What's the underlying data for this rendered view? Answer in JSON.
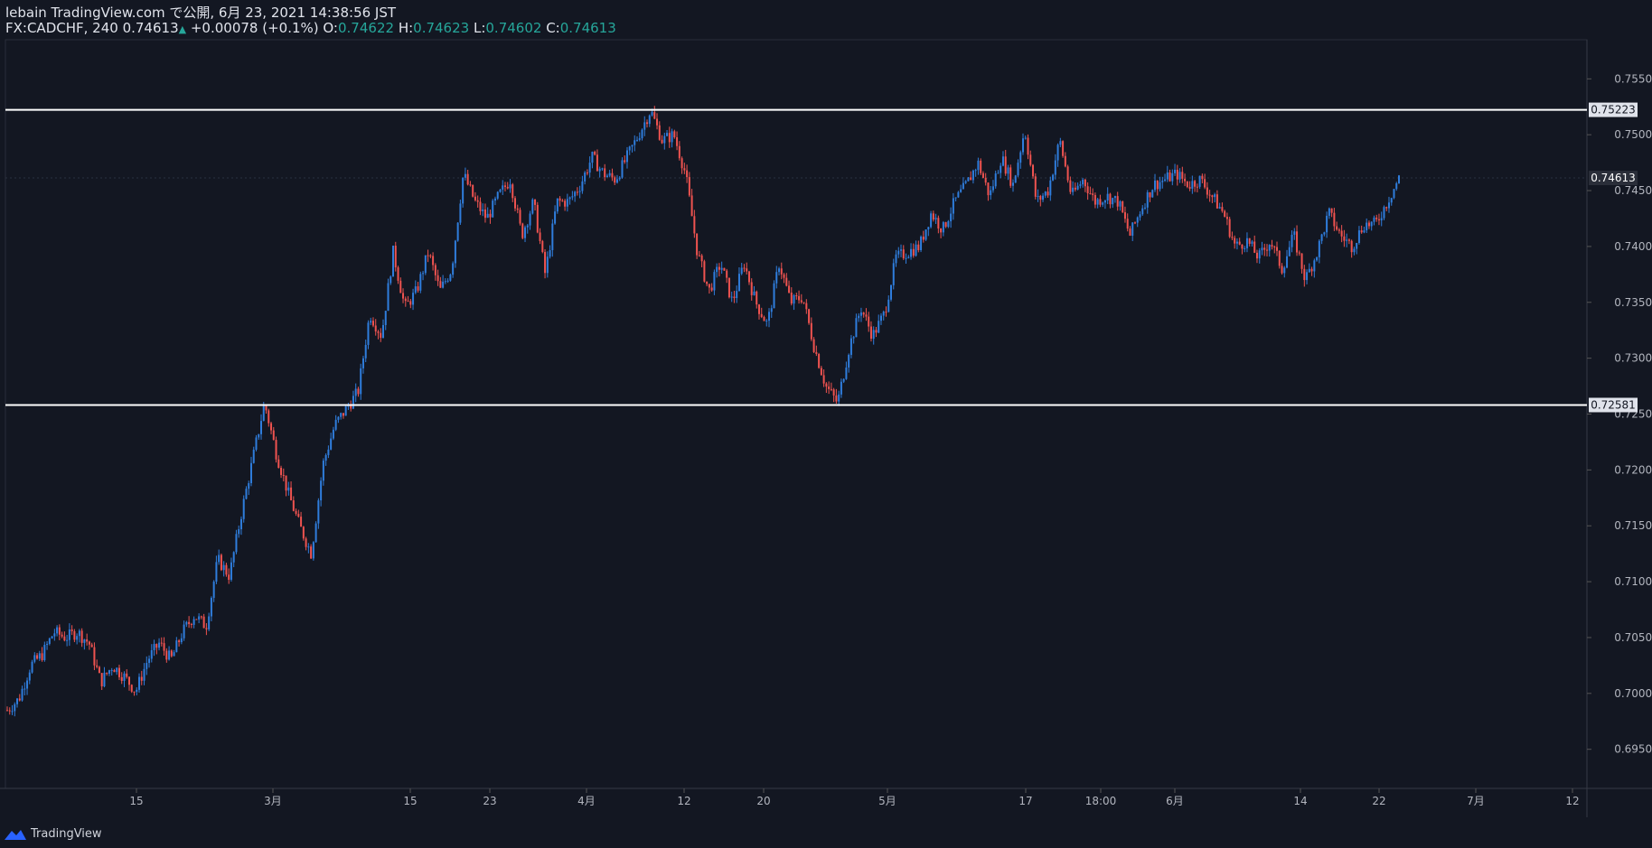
{
  "header": {
    "line1": "lebain TradingView.com で公開, 6月 23, 2021 14:38:56 JST",
    "symbol": "FX:CADCHF, 240",
    "last": "0.74613",
    "change": "+0.00078 (+0.1%)",
    "o_label": "O:",
    "o": "0.74622",
    "h_label": "H:",
    "h": "0.74623",
    "l_label": "L:",
    "l": "0.74602",
    "c_label": "C:",
    "c": "0.74613"
  },
  "footer": {
    "brand": "TradingView"
  },
  "colors": {
    "background": "#131722",
    "up": "#2f7ddc",
    "down": "#ef5350",
    "grid": "#1e2230",
    "text": "#b2b5be",
    "hline": "#ffffff",
    "price_label_bg": "#e0e3eb"
  },
  "chart_data": {
    "type": "candlestick",
    "symbol": "FX:CADCHF",
    "interval": "240",
    "ylim": [
      0.6915,
      0.7585
    ],
    "y_ticks": [
      "0.75500",
      "0.75000",
      "0.74500",
      "0.74000",
      "0.73500",
      "0.73000",
      "0.72500",
      "0.72000",
      "0.71500",
      "0.71000",
      "0.70500",
      "0.70000",
      "0.69500"
    ],
    "x_ticks": [
      "15",
      "3月",
      "15",
      "23",
      "4月",
      "12",
      "20",
      "5月",
      "17",
      "18:00",
      "6月",
      "14",
      "22",
      "7月",
      "12"
    ],
    "horizontal_lines": [
      {
        "value": 0.75223,
        "label": "0.75223"
      },
      {
        "value": 0.72581,
        "label": "0.72581"
      }
    ],
    "last_price": {
      "value": 0.74613,
      "label": "0.74613"
    },
    "close_path": [
      0.6985,
      0.6995,
      0.7025,
      0.7035,
      0.7055,
      0.705,
      0.7055,
      0.7045,
      0.701,
      0.7025,
      0.7015,
      0.7002,
      0.703,
      0.7045,
      0.703,
      0.7055,
      0.707,
      0.706,
      0.712,
      0.7105,
      0.716,
      0.721,
      0.726,
      0.7215,
      0.718,
      0.715,
      0.7125,
      0.7205,
      0.724,
      0.7255,
      0.727,
      0.734,
      0.732,
      0.7395,
      0.7345,
      0.736,
      0.7395,
      0.736,
      0.738,
      0.7465,
      0.744,
      0.7425,
      0.7445,
      0.746,
      0.741,
      0.744,
      0.7375,
      0.744,
      0.744,
      0.7455,
      0.748,
      0.7465,
      0.746,
      0.748,
      0.75,
      0.7522,
      0.7495,
      0.75,
      0.7465,
      0.7395,
      0.736,
      0.7385,
      0.735,
      0.7385,
      0.735,
      0.733,
      0.7385,
      0.735,
      0.7355,
      0.731,
      0.7275,
      0.726,
      0.731,
      0.7345,
      0.732,
      0.734,
      0.739,
      0.7395,
      0.74,
      0.743,
      0.7415,
      0.744,
      0.7455,
      0.7475,
      0.7445,
      0.748,
      0.7455,
      0.7505,
      0.744,
      0.745,
      0.7495,
      0.7445,
      0.746,
      0.744,
      0.7445,
      0.744,
      0.741,
      0.7435,
      0.7455,
      0.746,
      0.7465,
      0.7455,
      0.746,
      0.7445,
      0.743,
      0.74,
      0.7405,
      0.739,
      0.7405,
      0.738,
      0.741,
      0.737,
      0.7395,
      0.743,
      0.741,
      0.74,
      0.742,
      0.742,
      0.744,
      0.7461
    ]
  }
}
